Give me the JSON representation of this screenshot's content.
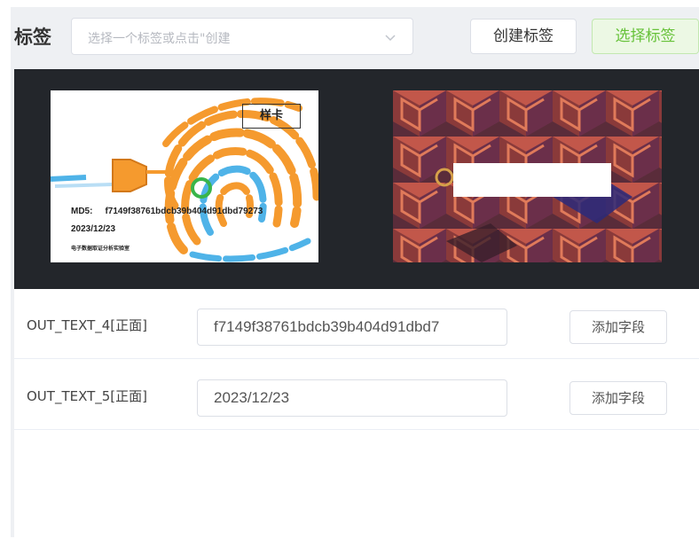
{
  "toolbar": {
    "tag_label": "标签",
    "select_placeholder": "选择一个标签或点击\"创建",
    "create_button": "创建标签",
    "choose_button": "选择标签"
  },
  "sample_card": {
    "badge": "样卡",
    "md5_key": "MD5:",
    "md5_value": "f7149f38761bdcb39b404d91dbd79273",
    "date": "2023/12/23",
    "caption": "电子数据取证分析实验室"
  },
  "fields": [
    {
      "label": "OUT_TEXT_4[正面]",
      "value": "f7149f38761bdcb39b404d91dbd7",
      "button": "添加字段"
    },
    {
      "label": "OUT_TEXT_5[正面]",
      "value": "2023/12/23",
      "button": "添加字段"
    }
  ],
  "colors": {
    "accent_green": "#67c23a",
    "image_area_bg": "#23262b",
    "fingerprint_orange": "#f59a2e",
    "fingerprint_blue": "#4fb3e8"
  },
  "icons": {
    "select_chevron": "chevron-down-icon"
  }
}
